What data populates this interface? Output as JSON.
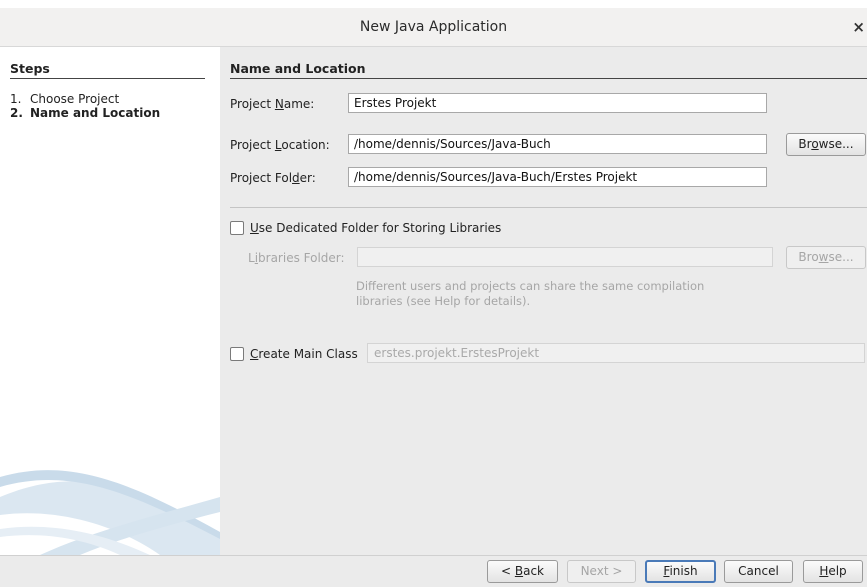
{
  "window": {
    "title": "New Java Application",
    "close_glyph": "×"
  },
  "steps": {
    "heading": "Steps",
    "items": [
      {
        "num": "1.",
        "label": "Choose Project"
      },
      {
        "num": "2.",
        "label": "Name and Location"
      }
    ]
  },
  "panel": {
    "heading": "Name and Location",
    "project_name": {
      "label_pre": "Project ",
      "label_u": "N",
      "label_post": "ame:",
      "value": "Erstes Projekt"
    },
    "project_location": {
      "label_pre": "Project ",
      "label_u": "L",
      "label_post": "ocation:",
      "value": "/home/dennis/Sources/Java-Buch",
      "browse_pre": "Br",
      "browse_u": "o",
      "browse_post": "wse..."
    },
    "project_folder": {
      "label_pre": "Project Fol",
      "label_u": "d",
      "label_post": "er:",
      "value": "/home/dennis/Sources/Java-Buch/Erstes Projekt"
    },
    "dedicated_folder": {
      "label_u": "U",
      "label_post": "se Dedicated Folder for Storing Libraries",
      "checked": false
    },
    "libraries_folder": {
      "label_pre": "L",
      "label_u": "i",
      "label_post": "braries Folder:",
      "value": "",
      "browse_pre": "Bro",
      "browse_u": "w",
      "browse_post": "se..."
    },
    "help_line1": "Different users and projects can share the same compilation",
    "help_line2": "libraries (see Help for details).",
    "main_class": {
      "label_u": "C",
      "label_post": "reate Main Class",
      "value": "erstes.projekt.ErstesProjekt",
      "checked": false
    }
  },
  "footer": {
    "back": {
      "pre": "< ",
      "u": "B",
      "post": "ack"
    },
    "next": "Next >",
    "finish": {
      "u": "F",
      "post": "inish"
    },
    "cancel": "Cancel",
    "help": {
      "u": "H",
      "post": "elp"
    }
  },
  "colors": {
    "dialog_bg": "#ebebeb",
    "steps_bg": "#ffffff",
    "default_button_border": "#4a7ab8"
  }
}
